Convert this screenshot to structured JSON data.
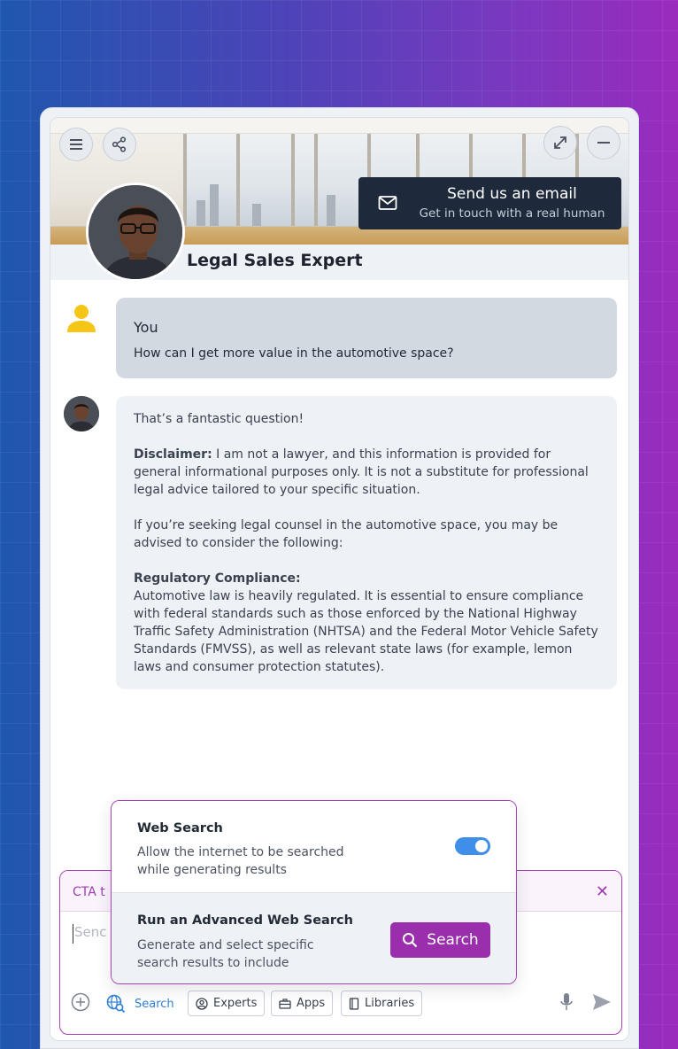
{
  "header": {
    "email_title": "Send us an email",
    "email_subtitle": "Get in touch with a real human",
    "expert_name": "Legal Sales Expert"
  },
  "messages": {
    "you_label": "You",
    "you_text": "How can I get more value in the automotive space?",
    "bot_p1": "That’s a fantastic question!",
    "bot_disclaimer_label": "Disclaimer:",
    "bot_disclaimer_text": " I am not a lawyer, and this information is provided for general informational purposes only. It is not a substitute for professional legal advice tailored to your specific situation.",
    "bot_p3": "If you’re seeking legal counsel in the automotive space, you may be advised to consider the following:",
    "bot_reg_label": "Regulatory Compliance:",
    "bot_reg_text": "Automotive law is heavily regulated. It is essential to ensure compliance with federal standards such as those enforced by the National Highway Traffic Safety Administration (NHTSA) and the Federal Motor Vehicle Safety Standards (FMVSS), as well as relevant state laws (for example, lemon laws and consumer protection statutes)."
  },
  "popover": {
    "web_search_title": "Web Search",
    "web_search_desc": "Allow the internet to be searched while generating results",
    "web_search_enabled": true,
    "advanced_title": "Run an Advanced Web Search",
    "advanced_desc": "Generate and select specific search results to include",
    "search_button": "Search"
  },
  "input": {
    "cta_text": "CTA t",
    "placeholder": "Senc"
  },
  "toolbar": {
    "search": "Search",
    "experts": "Experts",
    "apps": "Apps",
    "libraries": "Libraries"
  },
  "colors": {
    "accent_purple": "#9a2eac",
    "accent_blue": "#3f8ee8",
    "dark_button": "#1e2a3b",
    "user_icon": "#f5c518"
  }
}
